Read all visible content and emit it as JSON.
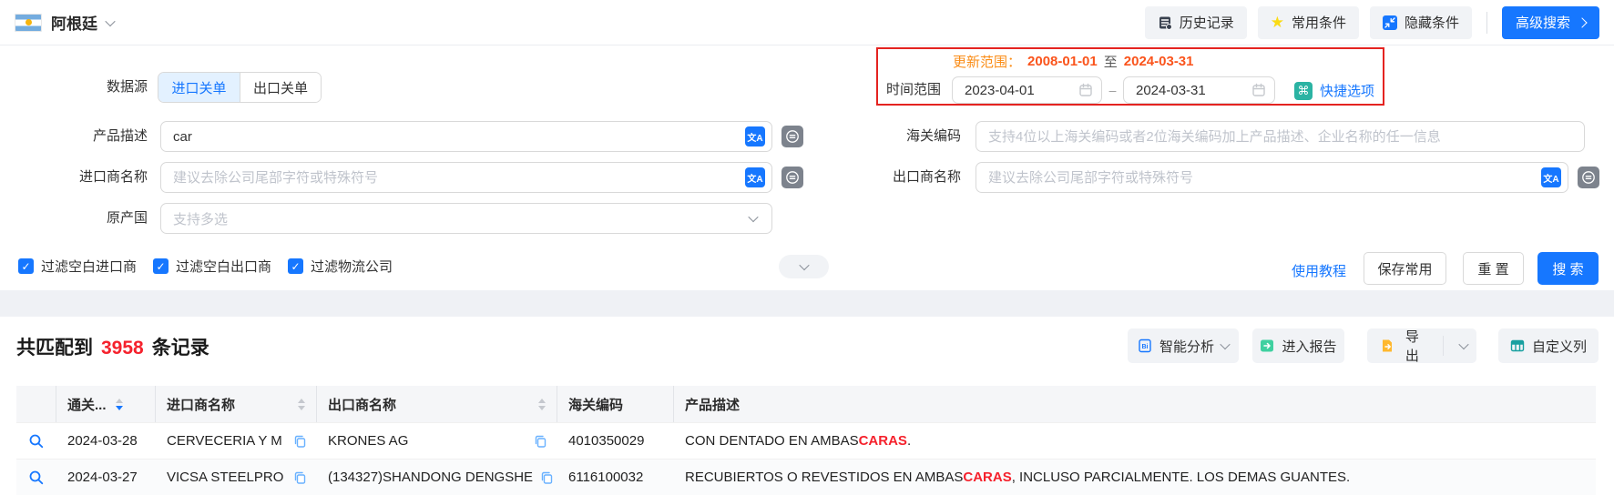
{
  "header": {
    "country": "阿根廷",
    "history_btn": "历史记录",
    "favorites_btn": "常用条件",
    "hide_btn": "隐藏条件",
    "advanced_btn": "高级搜索"
  },
  "form": {
    "datasource": {
      "label": "数据源",
      "tabs": [
        {
          "label": "进口关单",
          "active": true
        },
        {
          "label": "出口关单",
          "active": false
        }
      ]
    },
    "update_range": {
      "label": "更新范围：",
      "start": "2008-01-01",
      "to": "至",
      "end": "2024-03-31"
    },
    "time_range": {
      "label": "时间范围",
      "start": "2023-04-01",
      "separator": "–",
      "end": "2024-03-31",
      "quick_options": "快捷选项"
    },
    "product_desc": {
      "label": "产品描述",
      "value": "car"
    },
    "hs_code": {
      "label": "海关编码",
      "placeholder": "支持4位以上海关编码或者2位海关编码加上产品描述、企业名称的任一信息"
    },
    "importer": {
      "label": "进口商名称",
      "placeholder": "建议去除公司尾部字符或特殊符号"
    },
    "exporter": {
      "label": "出口商名称",
      "placeholder": "建议去除公司尾部字符或特殊符号"
    },
    "origin": {
      "label": "原产国",
      "placeholder": "支持多选"
    },
    "filters": [
      "过滤空白进口商",
      "过滤空白出口商",
      "过滤物流公司"
    ],
    "actions": {
      "tutorial": "使用教程",
      "save": "保存常用",
      "reset": "重 置",
      "search": "搜 索"
    }
  },
  "results": {
    "summary": {
      "prefix": "共匹配到",
      "count": "3958",
      "suffix": "条记录"
    },
    "toolbar": {
      "analysis": "智能分析",
      "report": "进入报告",
      "export": "导出",
      "custom_columns": "自定义列"
    },
    "table": {
      "headers": {
        "date": "通关...",
        "importer": "进口商名称",
        "exporter": "出口商名称",
        "hs_code": "海关编码",
        "product_desc": "产品描述"
      },
      "rows": [
        {
          "date": "2024-03-28",
          "importer": "CERVECERIA Y M",
          "exporter": "KRONES AG",
          "hs_code": "4010350029",
          "desc_pre": "CON DENTADO EN AMBAS ",
          "desc_highlight": "CARAS",
          "desc_post": "."
        },
        {
          "date": "2024-03-27",
          "importer": "VICSA STEELPRO",
          "exporter": "(134327)SHANDONG DENGSHE",
          "hs_code": "6116100032",
          "desc_pre": "RECUBIERTOS O REVESTIDOS EN AMBAS ",
          "desc_highlight": "CARAS",
          "desc_post": ", INCLUSO PARCIALMENTE. LOS DEMAS GUANTES."
        }
      ]
    }
  },
  "icons": {
    "star": "★",
    "command": "⌘",
    "translate": "文A",
    "check": "✓"
  },
  "colors": {
    "accent": "#1677ff",
    "highlight_red": "#f5222d",
    "alert_border": "#e42320",
    "orange_label": "#fa8c16",
    "orange_date": "#fa541c",
    "teal": "#2bb3a3",
    "star_yellow": "#fadb14"
  }
}
